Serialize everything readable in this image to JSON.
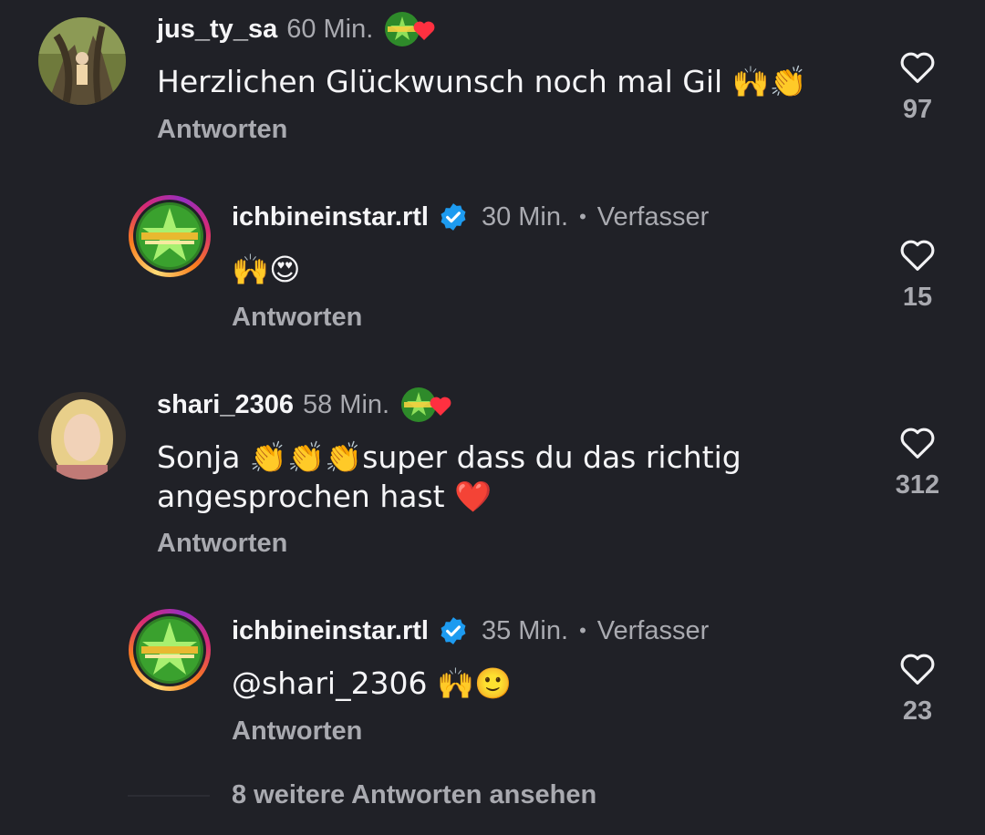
{
  "comments": [
    {
      "username": "jus_ty_sa",
      "time": "60 Min.",
      "text": "Herzlichen Glückwunsch noch mal Gil 🙌👏",
      "reply_label": "Antworten",
      "likes": "97",
      "creator_liked": true,
      "avatar_icon": "user-photo-tree"
    },
    {
      "username": "ichbineinstar.rtl",
      "time": "30 Min.",
      "author_label": "Verfasser",
      "verified": true,
      "text": "🙌😍",
      "reply_label": "Antworten",
      "likes": "15",
      "avatar_icon": "show-logo-star"
    },
    {
      "username": "shari_2306",
      "time": "58 Min.",
      "text": "Sonja 👏👏👏super dass du das richtig\nangesprochen hast ❤️",
      "reply_label": "Antworten",
      "likes": "312",
      "creator_liked": true,
      "avatar_icon": "user-photo-blonde"
    },
    {
      "username": "ichbineinstar.rtl",
      "time": "35 Min.",
      "author_label": "Verfasser",
      "verified": true,
      "text": "@shari_2306 🙌🙂",
      "reply_label": "Antworten",
      "likes": "23",
      "avatar_icon": "show-logo-star"
    }
  ],
  "more_replies": "8 weitere Antworten ansehen",
  "colors": {
    "background": "#202127",
    "muted_text": "#a9aab0",
    "verified_blue": "#1d9bf0",
    "heart_red": "#ff3040"
  }
}
